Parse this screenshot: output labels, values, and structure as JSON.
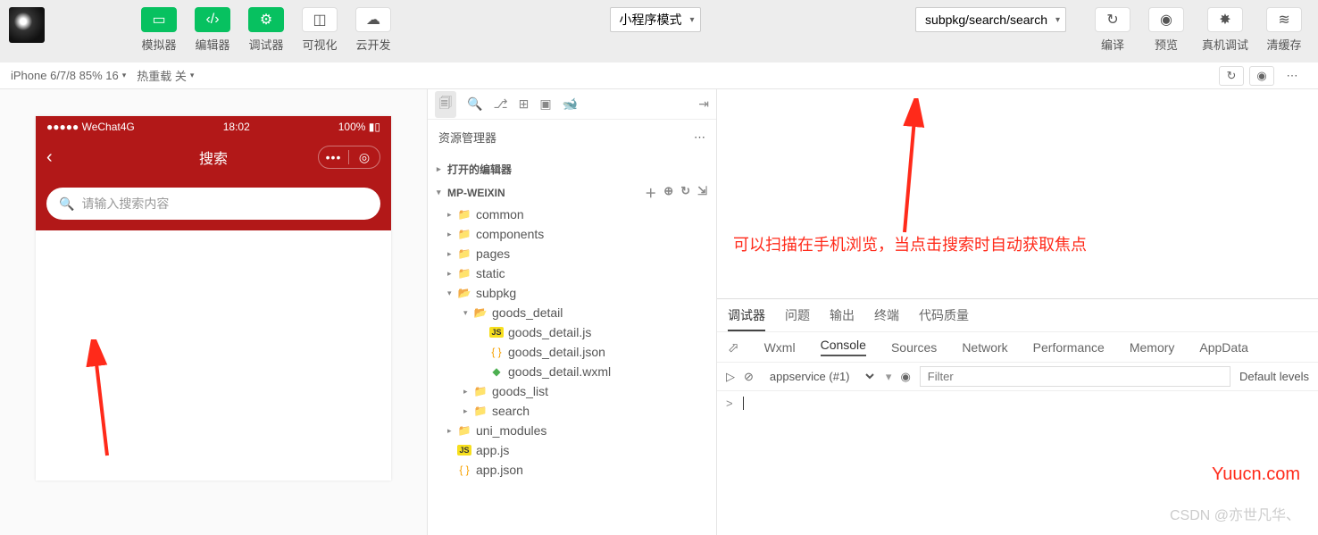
{
  "toolbar": {
    "buttons": [
      {
        "label": "模拟器",
        "icon": "phone",
        "style": "green"
      },
      {
        "label": "编辑器",
        "icon": "code",
        "style": "green"
      },
      {
        "label": "调试器",
        "icon": "tune",
        "style": "green"
      },
      {
        "label": "可视化",
        "icon": "layout",
        "style": "white"
      },
      {
        "label": "云开发",
        "icon": "cloud",
        "style": "white"
      }
    ],
    "mode_select": "小程序模式",
    "page_select": "subpkg/search/search",
    "right_buttons": [
      {
        "label": "编译",
        "icon": "refresh"
      },
      {
        "label": "预览",
        "icon": "eye"
      },
      {
        "label": "真机调试",
        "icon": "bug"
      },
      {
        "label": "清缓存",
        "icon": "stack"
      }
    ]
  },
  "second_bar": {
    "device": "iPhone 6/7/8 85% 16",
    "hot_reload": "热重载 关"
  },
  "phone": {
    "carrier": "WeChat4G",
    "signal": "●●●●●",
    "time": "18:02",
    "battery": "100%",
    "title": "搜索",
    "search_placeholder": "请输入搜索内容"
  },
  "explorer": {
    "title": "资源管理器",
    "open_editors": "打开的编辑器",
    "project": "MP-WEIXIN",
    "tree": {
      "common": "common",
      "components": "components",
      "pages": "pages",
      "static": "static",
      "subpkg": "subpkg",
      "goods_detail": "goods_detail",
      "goods_detail_js": "goods_detail.js",
      "goods_detail_json": "goods_detail.json",
      "goods_detail_wxml": "goods_detail.wxml",
      "goods_list": "goods_list",
      "search": "search",
      "uni_modules": "uni_modules",
      "app_js": "app.js",
      "app_json": "app.json"
    }
  },
  "annotation": {
    "text": "可以扫描在手机浏览，当点击搜索时自动获取焦点",
    "watermark": "Yuucn.com",
    "csdn": "CSDN @亦世凡华、"
  },
  "debugger": {
    "top_tabs": [
      "调试器",
      "问题",
      "输出",
      "终端",
      "代码质量"
    ],
    "dev_tabs": [
      "Wxml",
      "Console",
      "Sources",
      "Network",
      "Performance",
      "Memory",
      "AppData"
    ],
    "context": "appservice (#1)",
    "filter_placeholder": "Filter",
    "levels": "Default levels",
    "prompt": ">"
  }
}
